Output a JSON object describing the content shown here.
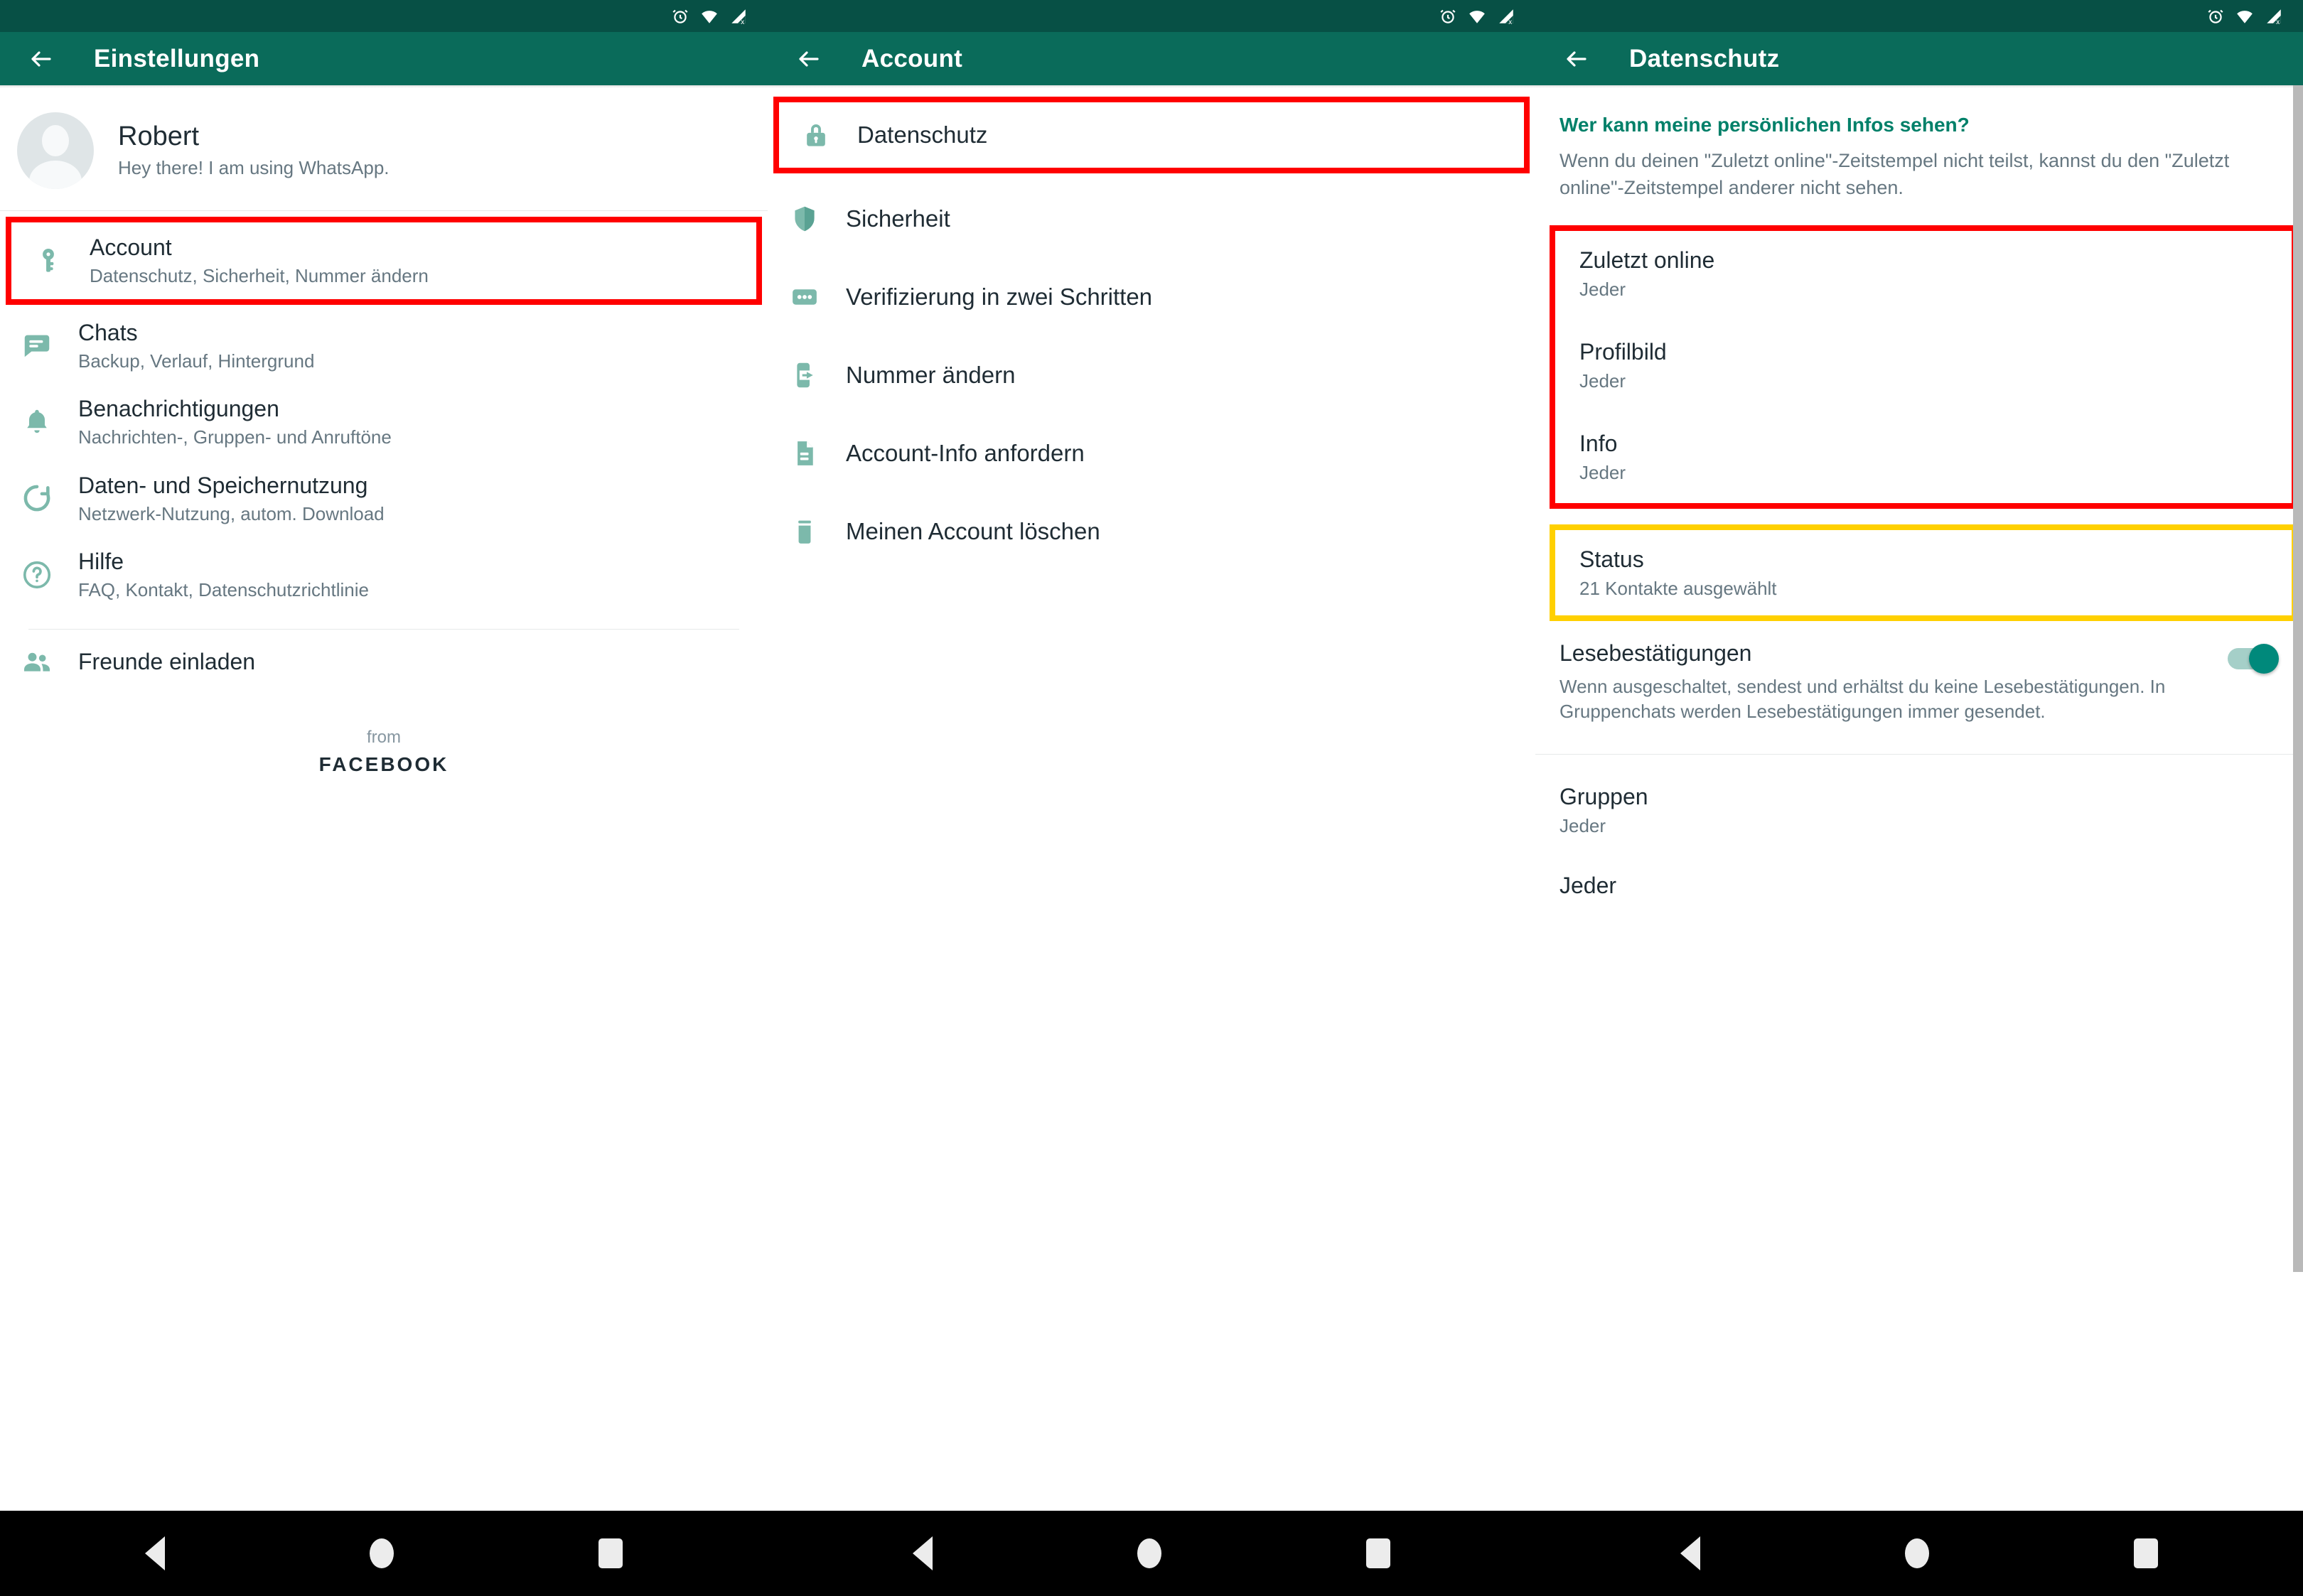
{
  "statusbar": {
    "icons": [
      "alarm-clock-icon",
      "wifi-icon",
      "signal-no-sim-icon"
    ]
  },
  "panels": [
    {
      "id": "settings",
      "appbar": {
        "title": "Einstellungen",
        "back_icon": "arrow-back-icon"
      },
      "profile": {
        "name": "Robert",
        "status": "Hey there! I am using WhatsApp.",
        "avatar_icon": "default-avatar-icon"
      },
      "items": [
        {
          "icon": "key-icon",
          "title": "Account",
          "subtitle": "Datenschutz, Sicherheit, Nummer ändern",
          "highlight": "red"
        },
        {
          "icon": "chat-bubble-icon",
          "title": "Chats",
          "subtitle": "Backup, Verlauf, Hintergrund",
          "highlight": "none"
        },
        {
          "icon": "bell-icon",
          "title": "Benachrichtigungen",
          "subtitle": "Nachrichten-, Gruppen- und Anruftöne",
          "highlight": "none"
        },
        {
          "icon": "data-usage-icon",
          "title": "Daten- und Speichernutzung",
          "subtitle": "Netzwerk-Nutzung, autom. Download",
          "highlight": "none"
        },
        {
          "icon": "help-circle-icon",
          "title": "Hilfe",
          "subtitle": "FAQ, Kontakt, Datenschutzrichtlinie",
          "highlight": "none"
        }
      ],
      "invite": {
        "icon": "people-icon",
        "title": "Freunde einladen"
      },
      "footer": {
        "from": "from",
        "brand": "FACEBOOK"
      }
    },
    {
      "id": "account",
      "appbar": {
        "title": "Account",
        "back_icon": "arrow-back-icon"
      },
      "items": [
        {
          "icon": "lock-icon",
          "label": "Datenschutz",
          "highlight": "red"
        },
        {
          "icon": "shield-icon",
          "label": "Sicherheit",
          "highlight": "none"
        },
        {
          "icon": "two-step-dots-icon",
          "label": "Verifizierung in zwei Schritten",
          "highlight": "none"
        },
        {
          "icon": "phone-change-icon",
          "label": "Nummer ändern",
          "highlight": "none"
        },
        {
          "icon": "document-icon",
          "label": "Account-Info anfordern",
          "highlight": "none"
        },
        {
          "icon": "trash-icon",
          "label": "Meinen Account löschen",
          "highlight": "none"
        }
      ]
    },
    {
      "id": "privacy",
      "appbar": {
        "title": "Datenschutz",
        "back_icon": "arrow-back-icon"
      },
      "section": {
        "heading": "Wer kann meine persönlichen Infos sehen?",
        "description": "Wenn du deinen \"Zuletzt online\"-Zeitstempel nicht teilst, kannst du den \"Zuletzt online\"-Zeitstempel anderer nicht sehen."
      },
      "privacy_group_red": [
        {
          "title": "Zuletzt online",
          "value": "Jeder"
        },
        {
          "title": "Profilbild",
          "value": "Jeder"
        },
        {
          "title": "Info",
          "value": "Jeder"
        }
      ],
      "status_item": {
        "title": "Status",
        "value": "21 Kontakte ausgewählt",
        "highlight": "yellow"
      },
      "read_receipts": {
        "title": "Lesebestätigungen",
        "description": "Wenn ausgeschaltet, sendest und erhältst du keine Lesebestätigungen. In Gruppenchats werden Lesebestätigungen immer gesendet.",
        "toggle_on": true
      },
      "groups_item": {
        "title": "Gruppen",
        "value": "Jeder"
      },
      "cutoff_item": {
        "title": "Jeder"
      }
    }
  ],
  "navbar": {
    "back_label": "back-triangle",
    "home_label": "home-circle",
    "recents_label": "recents-square"
  },
  "colors": {
    "statusbar": "#075045",
    "appbar": "#0a6b5a",
    "accent_green": "#008069",
    "icon_green": "#7cb9ab",
    "highlight_red": "#ff0000",
    "highlight_yellow": "#ffd000",
    "toggle_on": "#00897b",
    "primary_text": "#1f2c34",
    "secondary_text": "#667781"
  }
}
